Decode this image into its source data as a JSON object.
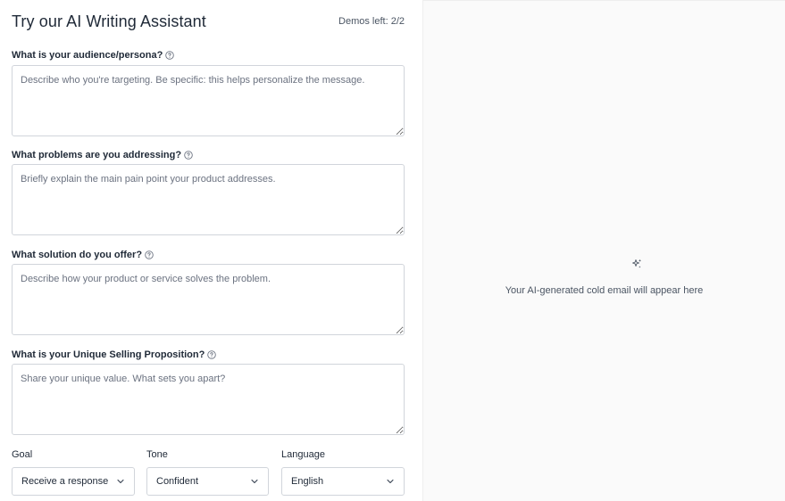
{
  "header": {
    "title": "Try our AI Writing Assistant",
    "demos_left": "Demos left: 2/2"
  },
  "fields": [
    {
      "label": "What is your audience/persona?",
      "placeholder": "Describe who you're targeting. Be specific: this helps personalize the message."
    },
    {
      "label": "What problems are you addressing?",
      "placeholder": "Briefly explain the main pain point your product addresses."
    },
    {
      "label": "What solution do you offer?",
      "placeholder": "Describe how your product or service solves the problem."
    },
    {
      "label": "What is your Unique Selling Proposition?",
      "placeholder": "Share your unique value. What sets you apart?"
    }
  ],
  "selects": {
    "goal": {
      "label": "Goal",
      "value": "Receive a response"
    },
    "tone": {
      "label": "Tone",
      "value": "Confident"
    },
    "language": {
      "label": "Language",
      "value": "English"
    }
  },
  "output": {
    "icon": "sparkle-icon",
    "placeholder": "Your AI-generated cold email will appear here"
  },
  "colors": {
    "border": "#d1d5db",
    "panel_bg": "#fafafa",
    "text": "#1f2937",
    "muted": "#6b7280"
  }
}
